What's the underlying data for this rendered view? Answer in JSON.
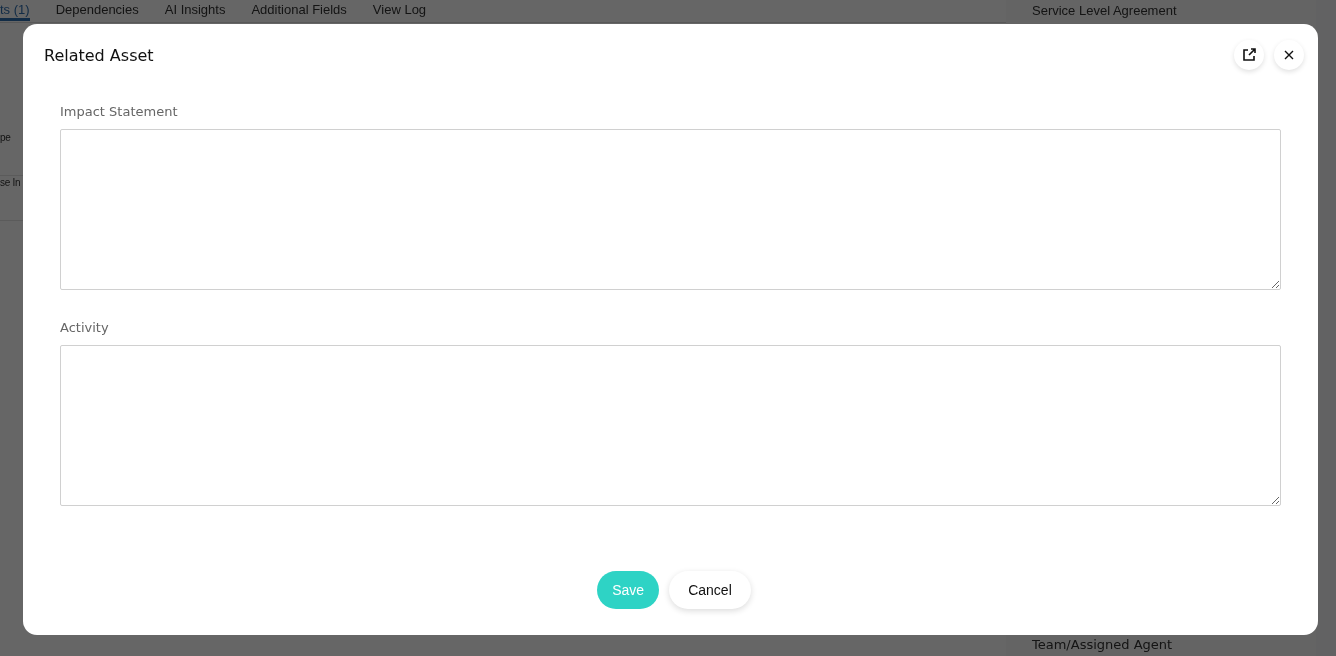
{
  "background": {
    "tabs": [
      {
        "label": "ts (1)",
        "selected": true
      },
      {
        "label": "Dependencies",
        "selected": false
      },
      {
        "label": "AI Insights",
        "selected": false
      },
      {
        "label": "Additional Fields",
        "selected": false
      },
      {
        "label": "View Log",
        "selected": false
      }
    ],
    "left_items": [
      "pe",
      "se In"
    ],
    "right_panel": {
      "title": "Service Level Agreement",
      "footer": "Team/Assigned Agent"
    }
  },
  "dialog": {
    "title": "Related Asset",
    "fields": [
      {
        "label": "Impact Statement"
      },
      {
        "label": "Activity"
      }
    ],
    "buttons": [
      {
        "label": "Save",
        "kind": "primary"
      },
      {
        "label": "Cancel",
        "kind": "secondary"
      }
    ]
  }
}
